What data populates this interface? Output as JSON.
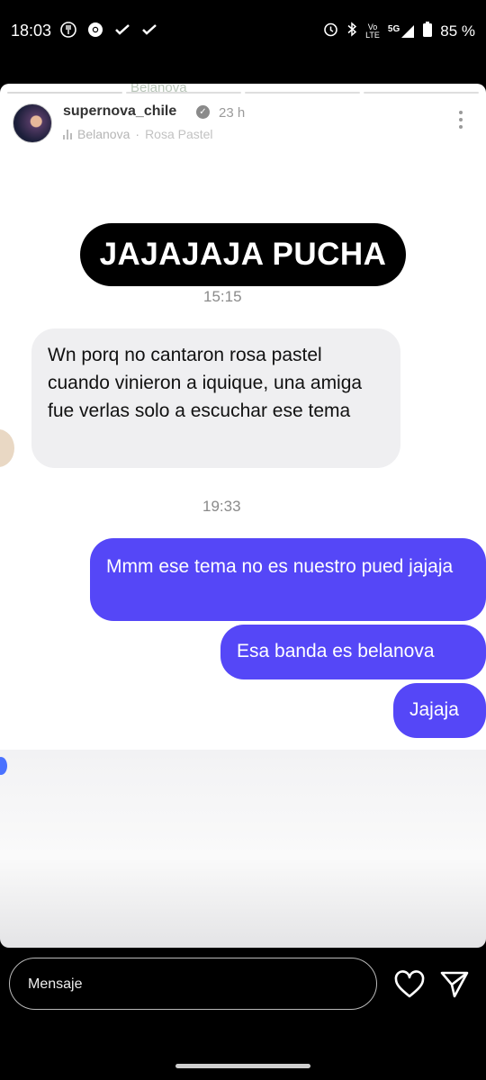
{
  "status_bar": {
    "time": "18:03",
    "left_icons": [
      "fork-knife-icon",
      "chrome-icon",
      "check-heart-icon",
      "check-heart-icon-2"
    ],
    "right_icons": [
      "alarm-icon",
      "bluetooth-icon",
      "volte-icon",
      "signal-5g-icon",
      "battery-icon"
    ],
    "volte_top": "Vo",
    "volte_bottom": "LTE",
    "network": "5G",
    "battery": "85 %"
  },
  "story": {
    "ghost_label": "Belanova",
    "progress_segments": 4,
    "username": "supernova_chile",
    "age": "23 h",
    "music_artist": "Belanova",
    "music_separator": "·",
    "music_song": "Rosa Pastel"
  },
  "chat": {
    "headline": "JAJAJAJA PUCHA",
    "timestamp_1": "15:15",
    "received_message": "Wn porq no cantaron rosa pastel cuando vinieron a iquique, una amiga fue verlas solo a escuchar ese tema",
    "timestamp_2": "19:33",
    "sent_1": "Mmm ese tema no es nuestro pued jajaja",
    "sent_2": "Esa banda es belanova",
    "sent_3": "Jajaja"
  },
  "bottom_bar": {
    "message_placeholder": "Mensaje"
  },
  "colors": {
    "sent_bubble": "#5547f7",
    "received_bubble": "#efeff1",
    "headline_bg": "#000000"
  }
}
